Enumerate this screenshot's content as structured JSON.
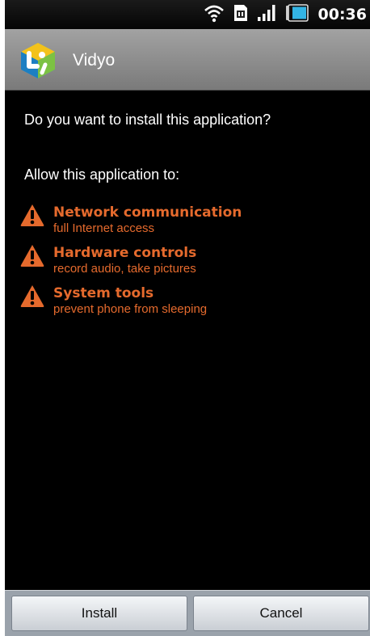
{
  "status_bar": {
    "time": "00:36",
    "icons": [
      "wifi-icon",
      "sim-icon",
      "signal-icon",
      "battery-icon"
    ]
  },
  "title_bar": {
    "app_name": "Vidyo",
    "app_icon": "vidyo-app-icon"
  },
  "content": {
    "question": "Do you want to install this application?",
    "allow_heading": "Allow this application to:",
    "permissions": [
      {
        "title": "Network communication",
        "description": "full Internet access",
        "icon": "warning-icon"
      },
      {
        "title": "Hardware controls",
        "description": "record audio, take pictures",
        "icon": "warning-icon"
      },
      {
        "title": "System tools",
        "description": "prevent phone from sleeping",
        "icon": "warning-icon"
      }
    ]
  },
  "buttons": {
    "install_label": "Install",
    "cancel_label": "Cancel"
  },
  "colors": {
    "permission_text": "#e56a2d",
    "warning_fill": "#e56a2d",
    "background": "#000000",
    "battery": "#33b5e5"
  }
}
